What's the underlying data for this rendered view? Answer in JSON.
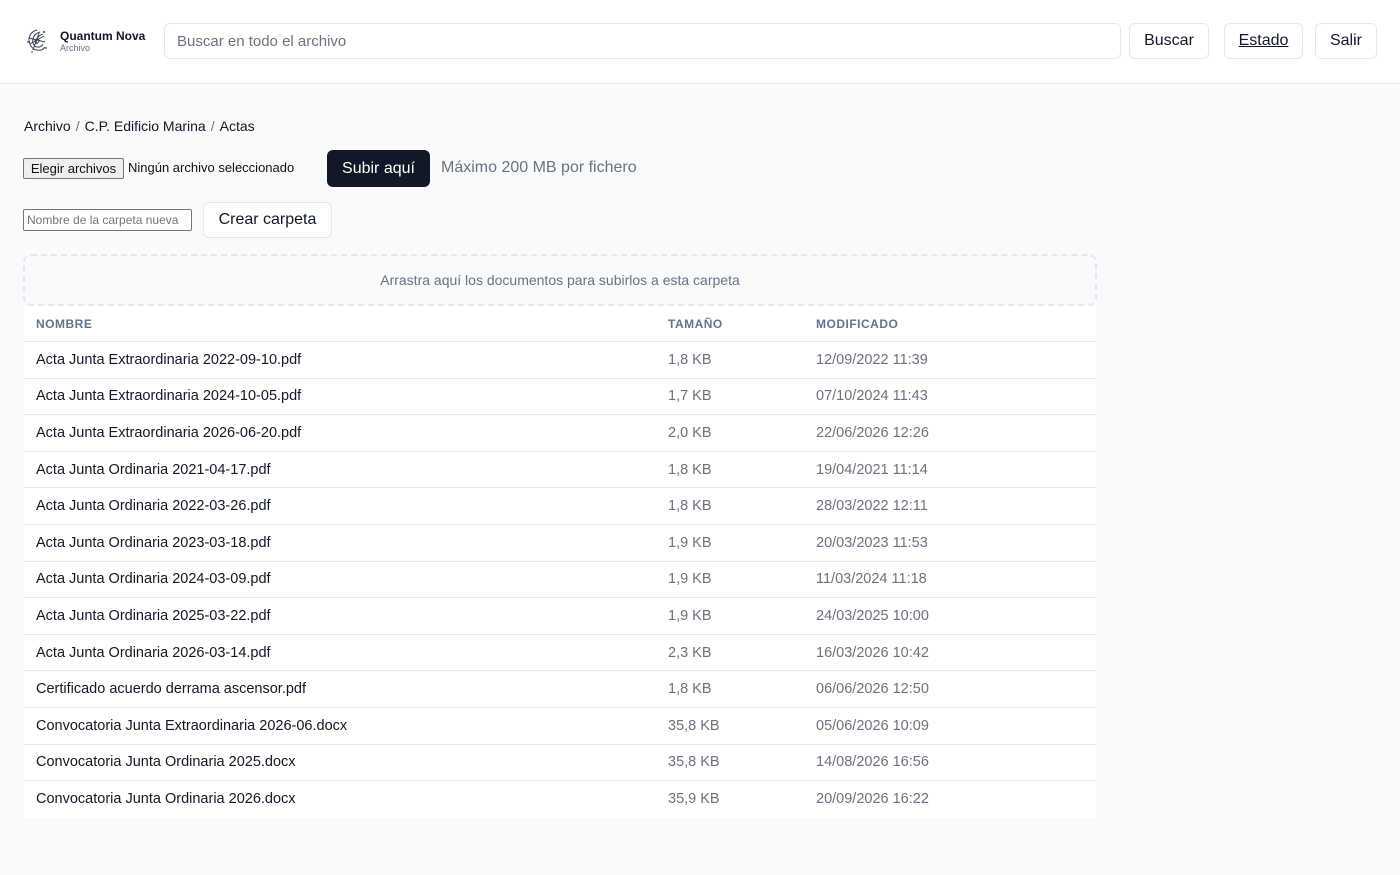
{
  "header": {
    "brand_name": "Quantum Nova",
    "brand_sub": "Archivo",
    "logo_icon": "quantum-swirl-icon",
    "search_placeholder": "Buscar en todo el archivo",
    "search_value": "",
    "buscar_label": "Buscar",
    "estado_label": "Estado",
    "salir_label": "Salir"
  },
  "breadcrumb": {
    "items": [
      "Archivo",
      "C.P. Edificio Marina",
      "Actas"
    ],
    "separator": "/"
  },
  "upload": {
    "choose_label": "Elegir archivos",
    "status": "Ningún archivo seleccionado",
    "upload_label": "Subir aquí",
    "hint": "Máximo 200 MB por fichero"
  },
  "folder": {
    "placeholder": "Nombre de la carpeta nueva",
    "value": "",
    "create_label": "Crear carpeta"
  },
  "dropzone": {
    "text": "Arrastra aquí los documentos para subirlos a esta carpeta"
  },
  "table": {
    "headers": {
      "name": "NOMBRE",
      "size": "TAMAÑO",
      "modified": "MODIFICADO"
    },
    "rows": [
      {
        "name": "Acta Junta Extraordinaria 2022-09-10.pdf",
        "size": "1,8 KB",
        "modified": "12/09/2022 11:39"
      },
      {
        "name": "Acta Junta Extraordinaria 2024-10-05.pdf",
        "size": "1,7 KB",
        "modified": "07/10/2024 11:43"
      },
      {
        "name": "Acta Junta Extraordinaria 2026-06-20.pdf",
        "size": "2,0 KB",
        "modified": "22/06/2026 12:26"
      },
      {
        "name": "Acta Junta Ordinaria 2021-04-17.pdf",
        "size": "1,8 KB",
        "modified": "19/04/2021 11:14"
      },
      {
        "name": "Acta Junta Ordinaria 2022-03-26.pdf",
        "size": "1,8 KB",
        "modified": "28/03/2022 12:11"
      },
      {
        "name": "Acta Junta Ordinaria 2023-03-18.pdf",
        "size": "1,9 KB",
        "modified": "20/03/2023 11:53"
      },
      {
        "name": "Acta Junta Ordinaria 2024-03-09.pdf",
        "size": "1,9 KB",
        "modified": "11/03/2024 11:18"
      },
      {
        "name": "Acta Junta Ordinaria 2025-03-22.pdf",
        "size": "1,9 KB",
        "modified": "24/03/2025 10:00"
      },
      {
        "name": "Acta Junta Ordinaria 2026-03-14.pdf",
        "size": "2,3 KB",
        "modified": "16/03/2026 10:42"
      },
      {
        "name": "Certificado acuerdo derrama ascensor.pdf",
        "size": "1,8 KB",
        "modified": "06/06/2026 12:50"
      },
      {
        "name": "Convocatoria Junta Extraordinaria 2026-06.docx",
        "size": "35,8 KB",
        "modified": "05/06/2026 10:09"
      },
      {
        "name": "Convocatoria Junta Ordinaria 2025.docx",
        "size": "35,8 KB",
        "modified": "14/08/2026 16:56"
      },
      {
        "name": "Convocatoria Junta Ordinaria 2026.docx",
        "size": "35,9 KB",
        "modified": "20/09/2026 16:22"
      }
    ]
  },
  "colors": {
    "primary_button": "#111827",
    "border": "#e5e7eb",
    "muted_text": "#6b7280",
    "page_background": "#f8fafc"
  }
}
